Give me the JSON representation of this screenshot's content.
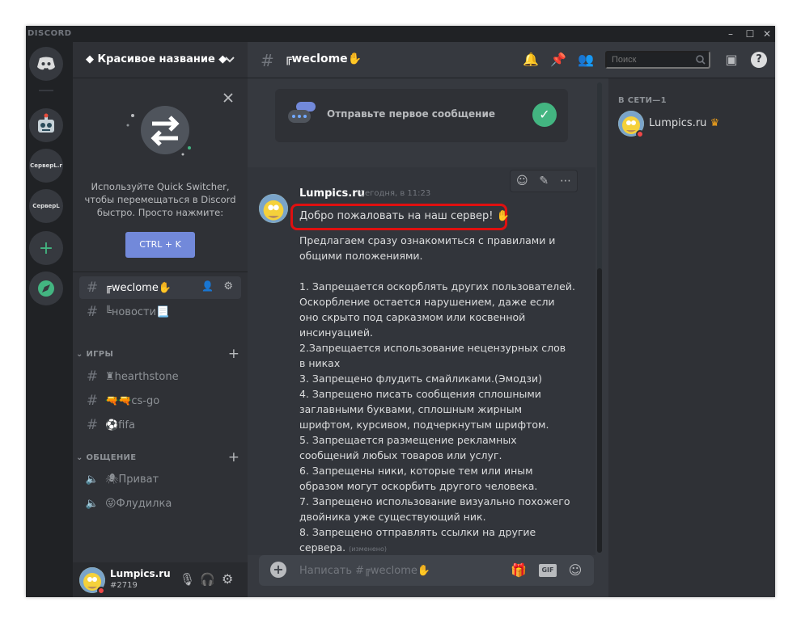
{
  "app": {
    "brand": "DISCORD",
    "window_controls": [
      "–",
      "☐",
      "✕"
    ]
  },
  "guilds": {
    "items": [
      {
        "name": "home",
        "label": ""
      },
      {
        "name": "robot-server",
        "label": ""
      },
      {
        "name": "server-1",
        "label": "СерверL.r"
      },
      {
        "name": "server-2",
        "label": "СерверL"
      },
      {
        "name": "add-server",
        "label": "+"
      },
      {
        "name": "explore",
        "label": ""
      }
    ]
  },
  "server": {
    "name": "◆ Красивое название ◆"
  },
  "quick_switcher": {
    "text": "Используйте Quick Switcher, чтобы перемещаться в Discord быстро. Просто нажмите:",
    "button": "CTRL + K"
  },
  "channels": {
    "top": [
      {
        "label": "╔weclome✋",
        "active": true
      },
      {
        "label": "╚новости📃",
        "active": false
      }
    ],
    "categories": [
      {
        "label": "ИГРЫ",
        "items": [
          "♜hearthstone",
          "🔫🔫cs-go",
          "⚽fifa"
        ]
      },
      {
        "label": "ОБЩЕНИЕ",
        "items": [
          "🕷Приват",
          "😜Флудилка"
        ]
      }
    ]
  },
  "user": {
    "name": "Lumpics.ru",
    "tag": "#2719"
  },
  "chat": {
    "channel": "╔weclome✋",
    "search_placeholder": "Поиск",
    "welcome_box": "Отправьте первое сообщение",
    "message": {
      "author": "Lumpics.ru",
      "timestamp": "Сегодня, в 11:23",
      "greeting": "Добро пожаловать на наш сервер! ✋",
      "body": "Предлагаем сразу ознакомиться с правилами и\nобщими положениями.\n\n1. Запрещается оскорблять других пользователей.\nОскорбление остается нарушением, даже если\nоно скрыто под сарказмом или косвенной\nинсинуацией.\n2.Запрещается использование нецензурных слов\nв никах\n3. Запрещено флудить смайликами.(Эмодзи)\n4. Запрещено писать сообщения сплошными\nзаглавными буквами, сплошным жирным\nшрифтом, курсивом, подчеркнутым шрифтом.\n5. Запрещается размещение рекламных\nсообщений любых товаров или услуг.\n6. Запрещены ники, которые тем или иным\nобразом могут оскорбить другого человека.\n7. Запрещено использование визуально похожего\nдвойника уже существующий ник.\n8. Запрещено отправлять ссылки на другие\nсервера.",
      "edited": "(изменено)"
    },
    "composer_placeholder": "Написать #╔weclome✋",
    "gif": "GIF"
  },
  "members": {
    "header": "В СЕТИ—1",
    "list": [
      {
        "name": "Lumpics.ru",
        "crown": "♛"
      }
    ]
  },
  "colors": {
    "accent": "#7289da",
    "online": "#43b581",
    "highlight": "#e01010",
    "crown": "#faa61a"
  }
}
